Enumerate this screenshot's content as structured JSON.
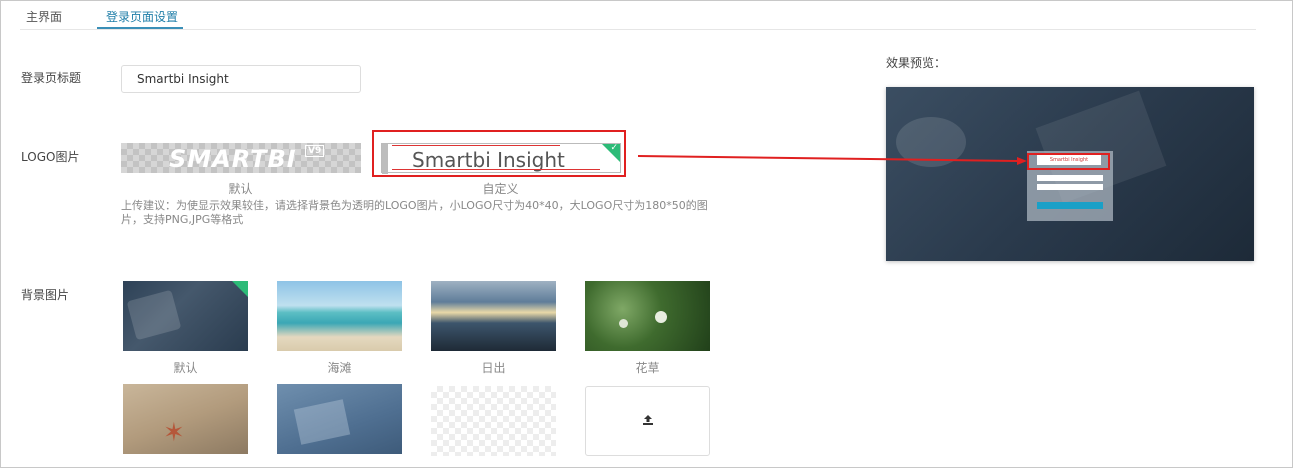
{
  "tabs": [
    {
      "label": "主界面"
    },
    {
      "label": "登录页面设置"
    }
  ],
  "form": {
    "title_label": "登录页标题",
    "title_value": "Smartbi Insight",
    "logo_label": "LOGO图片",
    "logo_default_wordmark": "SMARTBI",
    "logo_default_version": "V9",
    "logo_default_caption": "默认",
    "logo_custom_text": "Smartbi Insight",
    "logo_custom_caption": "自定义",
    "hint": "上传建议：为使显示效果较佳，请选择背景色为透明的LOGO图片，小LOGO尺寸为40*40，大LOGO尺寸为180*50的图片，支持PNG,JPG等格式",
    "bg_label": "背景图片",
    "backgrounds": [
      {
        "caption": "默认"
      },
      {
        "caption": "海滩"
      },
      {
        "caption": "日出"
      },
      {
        "caption": "花草"
      }
    ]
  },
  "preview": {
    "label": "效果预览：",
    "logo_text": "Smartbi Insight"
  },
  "colors": {
    "accent": "#1f7ea8",
    "highlight": "#e02020",
    "check": "#2dbb78"
  }
}
